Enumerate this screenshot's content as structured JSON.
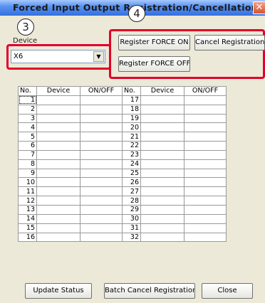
{
  "window": {
    "title": "Forced Input Output Registration/Cancellation",
    "close_glyph": "✕"
  },
  "callouts": {
    "three": "3",
    "four": "4"
  },
  "device": {
    "label": "Device",
    "value": "X6",
    "arrow_glyph": "▼"
  },
  "buttons": {
    "register_on": "Register FORCE ON",
    "cancel_registration": "Cancel Registration",
    "register_off": "Register FORCE OFF",
    "update_status": "Update Status",
    "batch_cancel": "Batch Cancel Registration",
    "close": "Close"
  },
  "table": {
    "headers": [
      "No.",
      "Device",
      "ON/OFF",
      "No.",
      "Device",
      "ON/OFF"
    ],
    "left_numbers": [
      "1",
      "2",
      "3",
      "4",
      "5",
      "6",
      "7",
      "8",
      "9",
      "10",
      "11",
      "12",
      "13",
      "14",
      "15",
      "16"
    ],
    "right_numbers": [
      "17",
      "18",
      "19",
      "20",
      "21",
      "22",
      "23",
      "24",
      "25",
      "26",
      "27",
      "28",
      "29",
      "30",
      "31",
      "32"
    ]
  },
  "colors": {
    "highlight_border": "#e0002a",
    "dialog_bg": "#ece9d8",
    "titlebar": "#3470e0"
  }
}
